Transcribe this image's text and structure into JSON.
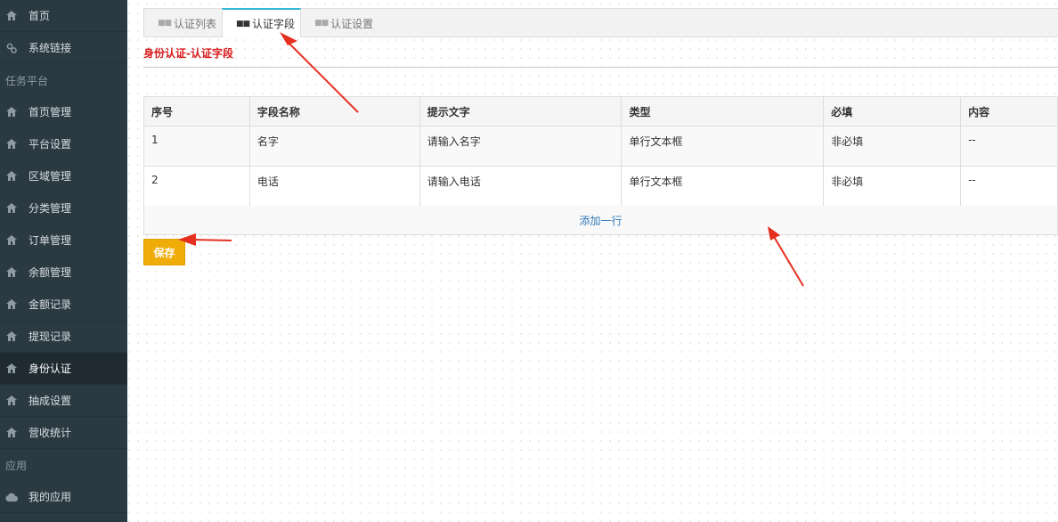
{
  "sidebar": {
    "items": [
      {
        "label": "首页",
        "icon": "home-icon"
      },
      {
        "label": "系统链接",
        "icon": "link-icon"
      }
    ],
    "group_task": "任务平台",
    "task_items": [
      {
        "label": "首页管理",
        "icon": "home-icon"
      },
      {
        "label": "平台设置",
        "icon": "home-icon"
      },
      {
        "label": "区域管理",
        "icon": "home-icon"
      },
      {
        "label": "分类管理",
        "icon": "home-icon"
      },
      {
        "label": "订单管理",
        "icon": "home-icon"
      },
      {
        "label": "余额管理",
        "icon": "home-icon"
      },
      {
        "label": "金额记录",
        "icon": "home-icon"
      },
      {
        "label": "提现记录",
        "icon": "home-icon"
      },
      {
        "label": "身份认证",
        "icon": "home-icon",
        "active": true
      },
      {
        "label": "抽成设置",
        "icon": "home-icon"
      },
      {
        "label": "营收统计",
        "icon": "home-icon"
      }
    ],
    "group_app": "应用",
    "app_items": [
      {
        "label": "我的应用",
        "icon": "cloud-icon"
      }
    ]
  },
  "tabs": [
    {
      "label": "认证列表"
    },
    {
      "label": "认证字段",
      "active": true
    },
    {
      "label": "认证设置"
    }
  ],
  "section_title": "身份认证-认证字段",
  "table": {
    "headers": [
      "序号",
      "字段名称",
      "提示文字",
      "类型",
      "必填",
      "内容"
    ],
    "rows": [
      [
        "1",
        "名字",
        "请输入名字",
        "单行文本框",
        "非必填",
        "--"
      ],
      [
        "2",
        "电话",
        "请输入电话",
        "单行文本框",
        "非必填",
        "--"
      ]
    ]
  },
  "add_row_label": "添加一行",
  "save_label": "保存",
  "colors": {
    "sidebar_bg": "#2b3a42",
    "accent_tab": "#34b6d6",
    "title_red": "#d71a1a",
    "save_btn": "#f0ad0a",
    "link_blue": "#337ab7",
    "annotation_arrow": "#e53020"
  }
}
